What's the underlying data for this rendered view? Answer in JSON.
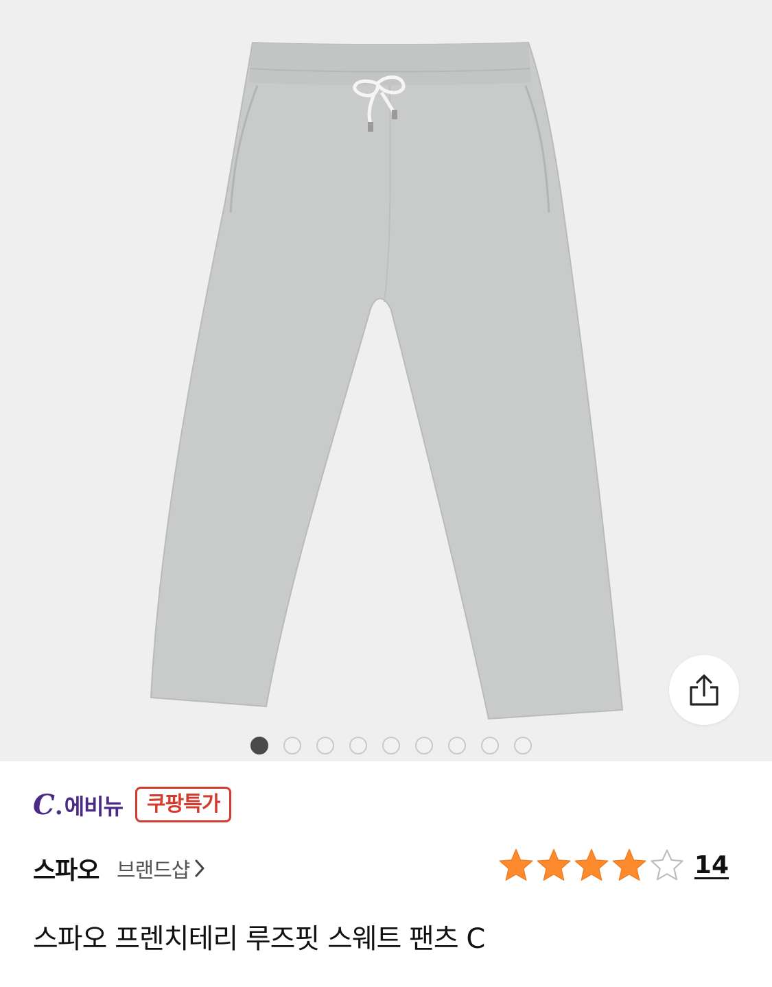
{
  "gallery": {
    "image_alt": "product-image-gray-sweat-pants",
    "page_count": 9,
    "active_page": 1
  },
  "share": {
    "icon": "share-icon"
  },
  "badges": {
    "seller_logo_c": "C",
    "seller_logo_dot": ".",
    "seller_logo_text": "에비뉴",
    "deal_label": "쿠팡특가"
  },
  "brand": {
    "name": "스파오",
    "shop_link": "브랜드샵"
  },
  "rating": {
    "stars": 4,
    "max_stars": 5,
    "review_count": "14"
  },
  "product": {
    "title": "스파오 프렌치테리 루즈핏 스웨트 팬츠 C"
  },
  "colors": {
    "seller_purple": "#4a2a86",
    "deal_red": "#d43a2e",
    "star_orange": "#fd8a2d",
    "pants_gray": "#c9cbcb"
  }
}
